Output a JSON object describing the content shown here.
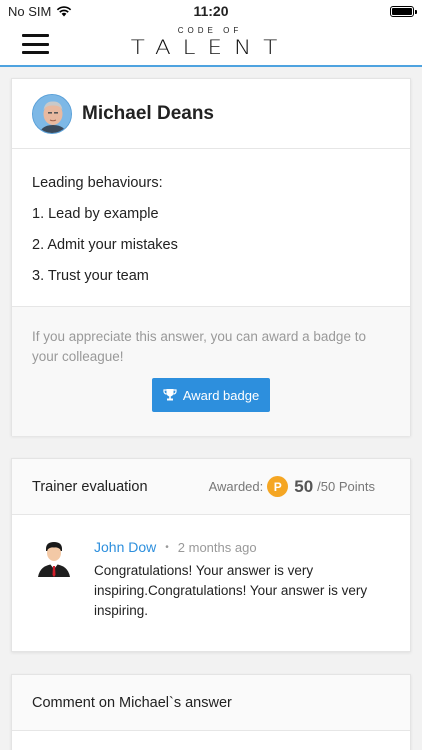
{
  "status_bar": {
    "carrier": "No SIM",
    "time": "11:20",
    "wifi_icon": "wifi-icon",
    "battery_icon": "battery-icon"
  },
  "header": {
    "menu_icon": "hamburger-menu-icon",
    "brand_top": "CODE OF",
    "brand_main": "TALENT"
  },
  "answer": {
    "author": "Michael Deans",
    "lines": [
      "Leading behaviours:",
      "1. Lead by example",
      "2. Admit your mistakes",
      "3. Trust your team"
    ],
    "appreciate_text": "If you appreciate this answer, you can award a badge to your colleague!",
    "award_button_label": "Award badge",
    "award_icon": "trophy-icon"
  },
  "trainer_evaluation": {
    "title": "Trainer evaluation",
    "awarded_label": "Awarded:",
    "coin_letter": "P",
    "score": "50",
    "score_suffix": "/50 Points",
    "comment": {
      "author": "John Dow",
      "time": "2 months ago",
      "text": "Congratulations! Your answer is very inspiring.Congratulations! Your answer is very inspiring."
    }
  },
  "comment_section": {
    "title": "Comment on Michael`s answer"
  },
  "colors": {
    "accent": "#2d8fdd",
    "coin": "#f5a623",
    "header_line": "#4ea3e0"
  }
}
